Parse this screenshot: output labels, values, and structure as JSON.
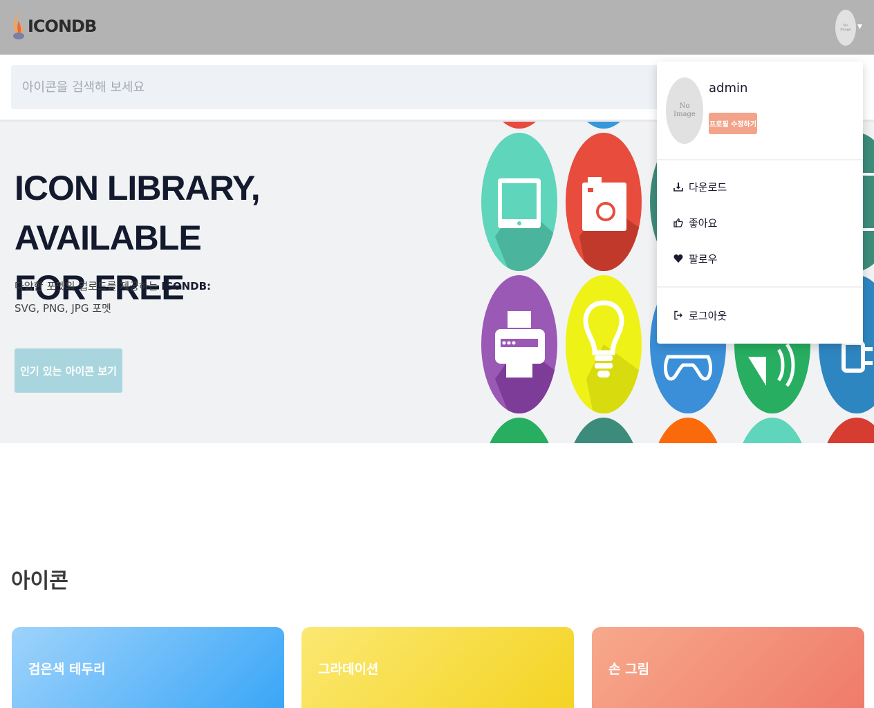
{
  "header": {
    "logo_text": "ICONDB",
    "avatar_text": "No\nImage"
  },
  "search": {
    "placeholder": "아이콘을 검색해 보세요"
  },
  "hero": {
    "title_line1": "ICON LIBRARY, AVAILABLE",
    "title_line2": "FOR FREE",
    "desc_line1_prefix": "다양한 포멧의 업로드를 제공하는 ",
    "desc_brand": "ICONDB:",
    "desc_line2": "SVG, PNG, JPG 포멧",
    "button_label": "인기 있는 아이콘 보기"
  },
  "dropdown": {
    "avatar_text": "No\nImage",
    "username": "admin",
    "edit_profile_label": "프로필 수정하기",
    "items": [
      {
        "label": "다운로드",
        "icon": "download-icon"
      },
      {
        "label": "좋아요",
        "icon": "thumbs-up-icon"
      },
      {
        "label": "팔로우",
        "icon": "heart-icon"
      }
    ],
    "logout_label": "로그아웃",
    "logout_icon": "logout-icon"
  },
  "section": {
    "title": "아이콘",
    "cards": [
      {
        "label": "검은색 테두리"
      },
      {
        "label": "그라데이션"
      },
      {
        "label": "손 그림"
      }
    ]
  },
  "colors": {
    "header_bg": "#b3b3b3",
    "search_bg": "#eef1f5",
    "hero_bg": "#f1f2f4",
    "hero_button": "#a9d6de",
    "edit_button": "#f3a38a",
    "card_blue": "#37a5f7",
    "card_yellow": "#f4d321",
    "card_salmon": "#ef7a69"
  }
}
